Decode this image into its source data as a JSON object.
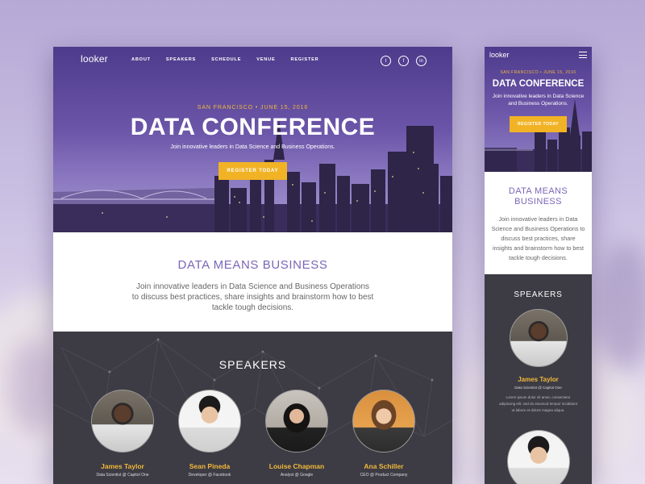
{
  "desktop": {
    "logo": "looker",
    "nav": [
      "ABOUT",
      "SPEAKERS",
      "SCHEDULE",
      "VENUE",
      "REGISTER"
    ],
    "social_icons": [
      "twitter-icon",
      "facebook-icon",
      "linkedin-icon"
    ],
    "hero": {
      "eyebrow": "SAN FRANCISCO • JUNE 15, 2016",
      "title": "DATA CONFERENCE",
      "subtitle": "Join innovative leaders in Data Science and Business Operations.",
      "cta": "REGISTER TODAY"
    },
    "about": {
      "heading": "DATA MEANS BUSINESS",
      "body": "Join innovative leaders in Data Science and Business Operations to discuss best practices, share insights and brainstorm how to best tackle tough decisions."
    },
    "speakers": {
      "heading": "SPEAKERS",
      "items": [
        {
          "name": "James Taylor",
          "role": "Data Scientist @ Capitol One"
        },
        {
          "name": "Sean Pineda",
          "role": "Developer @ Facebook"
        },
        {
          "name": "Louise Chapman",
          "role": "Analyst @ Google"
        },
        {
          "name": "Ana Schiller",
          "role": "CEO @ Product Company"
        }
      ]
    }
  },
  "mobile": {
    "logo": "looker",
    "hero": {
      "eyebrow": "SAN FRANCISCO • JUNE 15, 2016",
      "title": "DATA CONFERENCE",
      "subtitle": "Join innovative leaders in Data Science and Business Operations.",
      "cta": "REGISTER TODAY"
    },
    "about": {
      "heading": "DATA MEANS BUSINESS",
      "body": "Join innovative leaders in Data Science and Business Operations to discuss best practices, share insights and brainstorm how to best tackle tough decisions."
    },
    "speakers": {
      "heading": "SPEAKERS",
      "first": {
        "name": "James Taylor",
        "role": "Data Scientist @ Capitol One",
        "bio": "Lorem ipsum dolor sit amet, consectetur adipiscing elit, sed do eiusmod tempor incididunt ut labore et dolore magna aliqua."
      }
    }
  },
  "colors": {
    "accent": "#f1b325",
    "purple": "#7a66b8",
    "dark": "#3d3b44"
  }
}
